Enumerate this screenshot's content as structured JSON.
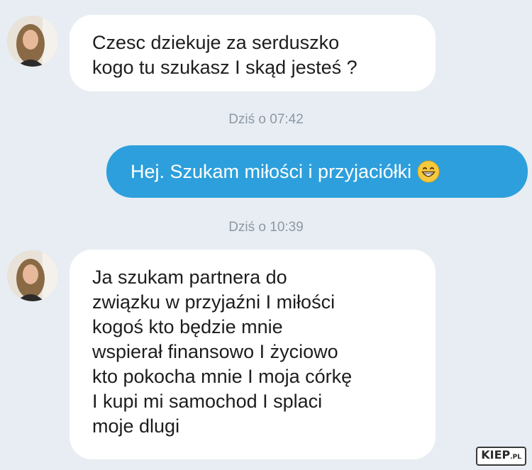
{
  "messages": [
    {
      "direction": "incoming",
      "lines": [
        "Czesc dziekuje za serduszko",
        "kogo tu szukasz I skąd jesteś ?"
      ]
    },
    {
      "timestamp": "Dziś o 07:42"
    },
    {
      "direction": "outgoing",
      "text": "Hej. Szukam miłości i przyjaciółki",
      "emoji": "grinning-face-emoji"
    },
    {
      "timestamp": "Dziś o 10:39"
    },
    {
      "direction": "incoming",
      "lines": [
        "Ja szukam partnera do",
        "związku w przyjaźni I miłości",
        "kogoś kto będzie mnie",
        "wspierał finansowo I życiowo",
        "kto pokocha mnie I moja córkę",
        "I kupi mi samochod I splaci",
        "moje dlugi"
      ]
    }
  ],
  "watermark": {
    "text": "KIEP",
    "suffix": ".PL"
  },
  "colors": {
    "background": "#e7edf3",
    "incoming_bubble": "#ffffff",
    "outgoing_bubble": "#2d9fdc",
    "timestamp": "#8e98a3"
  }
}
